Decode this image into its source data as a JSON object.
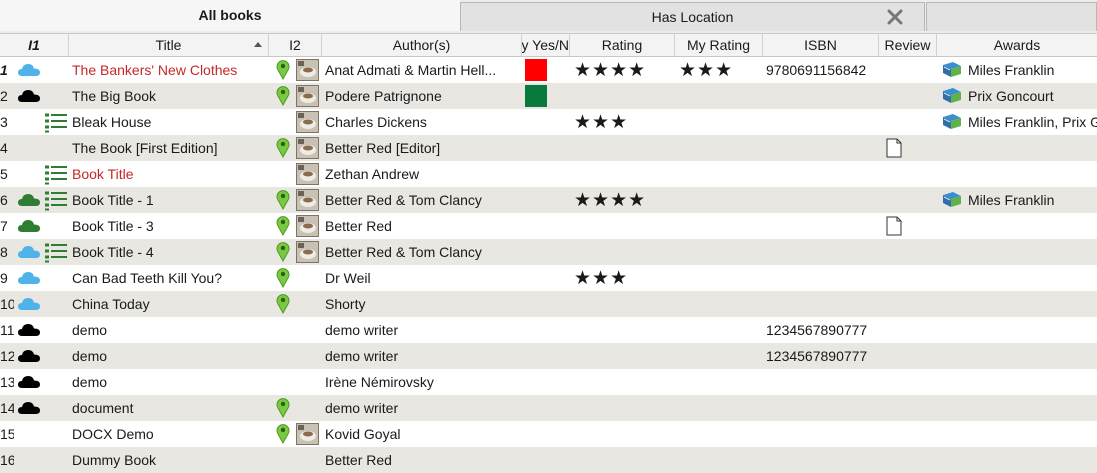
{
  "tabs": [
    {
      "label": "All books",
      "active": true
    },
    {
      "label": "Has Location",
      "active": false
    }
  ],
  "columns": [
    "I1",
    "Title",
    "I2",
    "Author(s)",
    "y Yes/N",
    "Rating",
    "My Rating",
    "ISBN",
    "Review",
    "Awards"
  ],
  "colors": {
    "red_swatch": "#ff0000",
    "green_swatch": "#0a7a3c",
    "accent_green": "#2e7d32",
    "alt_row": "#e8e7e2",
    "red_text": "#c62828"
  },
  "rows": [
    {
      "num": "1",
      "title": "The Bankers' New Clothes",
      "title_red": true,
      "author": "Anat Admati & Martin Hell...",
      "yesno": "red",
      "rating": "★★★★",
      "my_rating": "★★★",
      "isbn": "9780691156842",
      "review": false,
      "awards": "Miles Franklin",
      "loc": true,
      "thumb": true,
      "i1": [
        "cloud-blue"
      ]
    },
    {
      "num": "2",
      "title": "The Big Book",
      "title_red": false,
      "author": "Podere Patrignone",
      "yesno": "green",
      "rating": "",
      "my_rating": "",
      "isbn": "",
      "review": false,
      "awards": "Prix Goncourt",
      "loc": true,
      "thumb": true,
      "i1": [
        "cloud-black"
      ]
    },
    {
      "num": "3",
      "title": "Bleak House",
      "title_red": false,
      "author": "Charles Dickens",
      "yesno": "",
      "rating": "★★★",
      "my_rating": "",
      "isbn": "",
      "review": false,
      "awards": "Miles Franklin, Prix Gonc",
      "loc": false,
      "thumb": true,
      "i1": [
        "list"
      ]
    },
    {
      "num": "4",
      "title": "The Book [First Edition]",
      "title_red": false,
      "author": "Better Red [Editor]",
      "yesno": "",
      "rating": "",
      "my_rating": "",
      "isbn": "",
      "review": true,
      "awards": "",
      "loc": true,
      "thumb": true,
      "i1": []
    },
    {
      "num": "5",
      "title": "Book Title",
      "title_red": true,
      "author": "Zethan Andrew",
      "yesno": "",
      "rating": "",
      "my_rating": "",
      "isbn": "",
      "review": false,
      "awards": "",
      "loc": false,
      "thumb": true,
      "i1": [
        "list"
      ]
    },
    {
      "num": "6",
      "title": "Book Title -  1",
      "title_red": false,
      "author": "Better Red & Tom Clancy",
      "yesno": "",
      "rating": "★★★★",
      "my_rating": "",
      "isbn": "",
      "review": false,
      "awards": "Miles Franklin",
      "loc": true,
      "thumb": true,
      "i1": [
        "cloud-green",
        "list"
      ]
    },
    {
      "num": "7",
      "title": "Book Title -  3",
      "title_red": false,
      "author": "Better Red",
      "yesno": "",
      "rating": "",
      "my_rating": "",
      "isbn": "",
      "review": true,
      "awards": "",
      "loc": true,
      "thumb": true,
      "i1": [
        "cloud-green"
      ]
    },
    {
      "num": "8",
      "title": "Book Title -  4",
      "title_red": false,
      "author": "Better Red & Tom Clancy",
      "yesno": "",
      "rating": "",
      "my_rating": "",
      "isbn": "",
      "review": false,
      "awards": "",
      "loc": true,
      "thumb": true,
      "i1": [
        "cloud-blue",
        "list"
      ]
    },
    {
      "num": "9",
      "title": "Can Bad Teeth Kill You?",
      "title_red": false,
      "author": "Dr Weil",
      "yesno": "",
      "rating": "★★★",
      "my_rating": "",
      "isbn": "",
      "review": false,
      "awards": "",
      "loc": true,
      "thumb": false,
      "i1": [
        "cloud-blue"
      ]
    },
    {
      "num": "10",
      "title": "China Today",
      "title_red": false,
      "author": "Shorty",
      "yesno": "",
      "rating": "",
      "my_rating": "",
      "isbn": "",
      "review": false,
      "awards": "",
      "loc": true,
      "thumb": false,
      "i1": [
        "cloud-blue"
      ]
    },
    {
      "num": "11",
      "title": "demo",
      "title_red": false,
      "author": "demo writer",
      "yesno": "",
      "rating": "",
      "my_rating": "",
      "isbn": "1234567890777",
      "review": false,
      "awards": "",
      "loc": false,
      "thumb": false,
      "i1": [
        "cloud-black"
      ]
    },
    {
      "num": "12",
      "title": "demo",
      "title_red": false,
      "author": "demo writer",
      "yesno": "",
      "rating": "",
      "my_rating": "",
      "isbn": "1234567890777",
      "review": false,
      "awards": "",
      "loc": false,
      "thumb": false,
      "i1": [
        "cloud-black"
      ]
    },
    {
      "num": "13",
      "title": "demo",
      "title_red": false,
      "author": "Irène Némirovsky",
      "yesno": "",
      "rating": "",
      "my_rating": "",
      "isbn": "",
      "review": false,
      "awards": "",
      "loc": false,
      "thumb": false,
      "i1": [
        "cloud-black"
      ]
    },
    {
      "num": "14",
      "title": "document",
      "title_red": false,
      "author": "demo writer",
      "yesno": "",
      "rating": "",
      "my_rating": "",
      "isbn": "",
      "review": false,
      "awards": "",
      "loc": true,
      "thumb": false,
      "i1": [
        "cloud-black"
      ]
    },
    {
      "num": "15",
      "title": "DOCX Demo",
      "title_red": false,
      "author": "Kovid Goyal",
      "yesno": "",
      "rating": "",
      "my_rating": "",
      "isbn": "",
      "review": false,
      "awards": "",
      "loc": true,
      "thumb": true,
      "i1": []
    },
    {
      "num": "16",
      "title": "Dummy Book",
      "title_red": false,
      "author": "Better Red",
      "yesno": "",
      "rating": "",
      "my_rating": "",
      "isbn": "",
      "review": false,
      "awards": "",
      "loc": false,
      "thumb": false,
      "i1": []
    }
  ]
}
